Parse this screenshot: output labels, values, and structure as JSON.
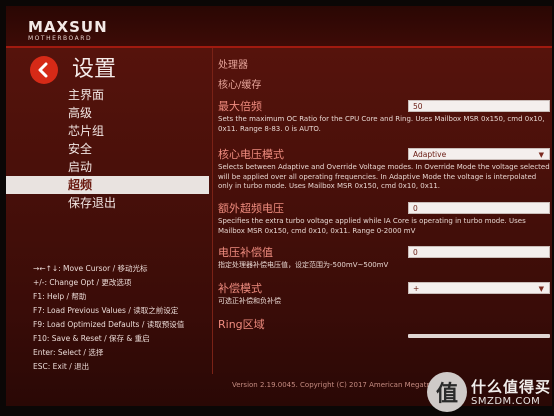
{
  "header": {
    "brand": "MAXSUN",
    "brand_sub": "MOTHERBOARD"
  },
  "left": {
    "page_title": "设置",
    "menu": [
      {
        "label": "主界面",
        "active": false
      },
      {
        "label": "高级",
        "active": false
      },
      {
        "label": "芯片组",
        "active": false
      },
      {
        "label": "安全",
        "active": false
      },
      {
        "label": "启动",
        "active": false
      },
      {
        "label": "超频",
        "active": true
      },
      {
        "label": "保存退出",
        "active": false
      }
    ],
    "keys": [
      "→←↑↓: Move Cursor / 移动光标",
      "+/-: Change Opt / 更改选项",
      "F1: Help / 帮助",
      "F7: Load Previous Values / 读取之前设定",
      "F9: Load Optimized Defaults / 读取预设值",
      "F10: Save & Reset / 保存 & 重启",
      "Enter: Select / 选择",
      "ESC: Exit / 退出"
    ]
  },
  "right": {
    "section_title": "处理器",
    "section_sub": "核心/缓存",
    "ratio": {
      "label": "最大倍频",
      "value": "50",
      "desc": "Sets the maximum OC Ratio for the CPU Core and Ring. Uses Mailbox MSR 0x150, cmd 0x10, 0x11. Range 8-83. 0 is AUTO."
    },
    "vmode": {
      "label": "核心电压模式",
      "value": "Adaptive",
      "desc": "Selects between Adaptive and Override Voltage modes. In Override Mode the voltage selected will be applied over all operating frequencies. In Adaptive Mode the voltage is interpolated only in turbo mode. Uses Mailbox MSR 0x150, cmd 0x10, 0x11."
    },
    "extra": {
      "label": "额外超频电压",
      "value": "0",
      "desc": "Specifies the extra turbo voltage applied while IA Core is operating in turbo mode. Uses Mailbox MSR 0x150, cmd 0x10, 0x11. Range 0-2000 mV"
    },
    "offset": {
      "label": "电压补偿值",
      "value": "0",
      "desc": "指定处理器补偿电压值，设定范围为-500mV~500mV"
    },
    "offset_mode": {
      "label": "补偿模式",
      "value": "+",
      "desc": "可选正补偿和负补偿"
    },
    "ring": {
      "label": "Ring区域"
    },
    "version": "Version 2.19.0045. Copyright (C) 2017 American Megatrends, Inc."
  },
  "watermark": {
    "glyph": "值",
    "text": "什么值得买",
    "url": "SMZDM.COM"
  }
}
